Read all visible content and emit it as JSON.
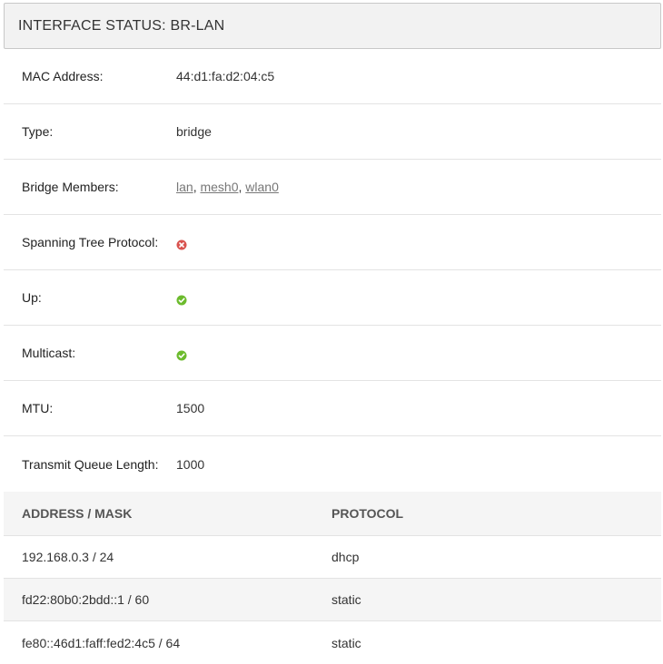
{
  "header": {
    "title": "INTERFACE STATUS: BR-LAN"
  },
  "details": {
    "mac": {
      "label": "MAC Address:",
      "value": "44:d1:fa:d2:04:c5"
    },
    "type": {
      "label": "Type:",
      "value": "bridge"
    },
    "bridge_members": {
      "label": "Bridge Members:",
      "links": [
        "lan",
        "mesh0",
        "wlan0"
      ],
      "separator": ", "
    },
    "stp": {
      "label": "Spanning Tree Protocol:",
      "status": "disabled",
      "icon": "x-circle-icon",
      "color": "#d9534f"
    },
    "up": {
      "label": "Up:",
      "status": "enabled",
      "icon": "check-circle-icon",
      "color": "#6cbb2d"
    },
    "multicast": {
      "label": "Multicast:",
      "status": "enabled",
      "icon": "check-circle-icon",
      "color": "#6cbb2d"
    },
    "mtu": {
      "label": "MTU:",
      "value": "1500"
    },
    "txqueuelen": {
      "label": "Transmit Queue Length:",
      "value": "1000"
    }
  },
  "addresses": {
    "columns": [
      "ADDRESS / MASK",
      "PROTOCOL"
    ],
    "rows": [
      {
        "address": "192.168.0.3 / 24",
        "protocol": "dhcp"
      },
      {
        "address": "fd22:80b0:2bdd::1 / 60",
        "protocol": "static"
      },
      {
        "address": "fe80::46d1:faff:fed2:4c5 / 64",
        "protocol": "static"
      }
    ]
  }
}
